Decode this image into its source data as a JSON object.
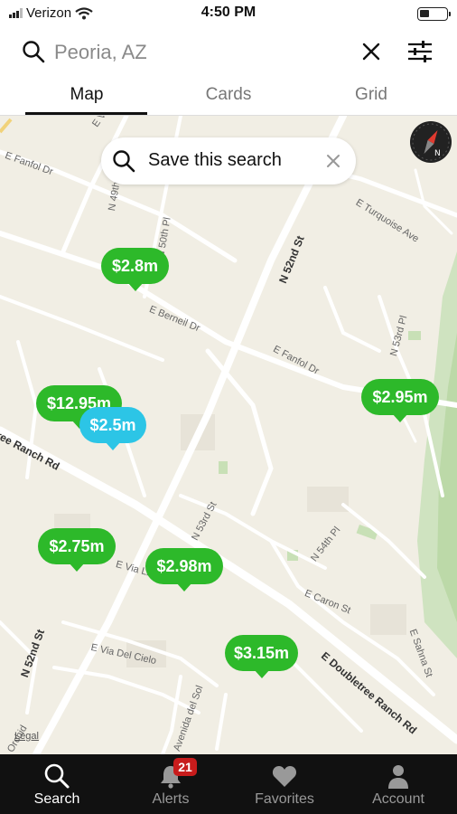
{
  "status_bar": {
    "carrier": "Verizon",
    "time": "4:50 PM"
  },
  "search": {
    "value": "Peoria, AZ"
  },
  "tabs": [
    {
      "label": "Map",
      "active": true
    },
    {
      "label": "Cards",
      "active": false
    },
    {
      "label": "Grid",
      "active": false
    }
  ],
  "map": {
    "save_search_label": "Save this search",
    "legal_label": "Legal",
    "compass_letter": "N",
    "streets": [
      "E Fanfol Dr",
      "E View Pl",
      "N 49th Pl",
      "N 50th Pl",
      "N 52nd St",
      "E Turquoise Ave",
      "E Berneil Dr",
      "E Fanfol Dr",
      "N 53rd Pl",
      "ree Ranch Rd",
      "N 53rd St",
      "N 54th Pl",
      "E Via Linda",
      "E Caron St",
      "E Sahna St",
      "N 52nd St",
      "E Via Del Cielo",
      "E Doubletree Ranch Rd",
      "Avenida del Sol",
      "Orchid"
    ],
    "pins": [
      {
        "price": "$2.8m",
        "color": "#2db92a"
      },
      {
        "price": "$12.95m",
        "color": "#2db92a"
      },
      {
        "price": "$2.5m",
        "color": "#2cc5e6"
      },
      {
        "price": "$2.95m",
        "color": "#2db92a"
      },
      {
        "price": "$2.75m",
        "color": "#2db92a"
      },
      {
        "price": "$2.98m",
        "color": "#2db92a"
      },
      {
        "price": "$3.15m",
        "color": "#2db92a"
      }
    ]
  },
  "bottom_nav": [
    {
      "label": "Search",
      "icon": "search-icon",
      "active": true
    },
    {
      "label": "Alerts",
      "icon": "bell-icon",
      "active": false,
      "badge": "21"
    },
    {
      "label": "Favorites",
      "icon": "heart-icon",
      "active": false
    },
    {
      "label": "Account",
      "icon": "person-icon",
      "active": false
    }
  ],
  "colors": {
    "pin_green": "#2db92a",
    "pin_selected": "#2cc5e6",
    "map_background": "#f1eee4",
    "badge_red": "#c81c1c",
    "nav_background": "#111111"
  }
}
